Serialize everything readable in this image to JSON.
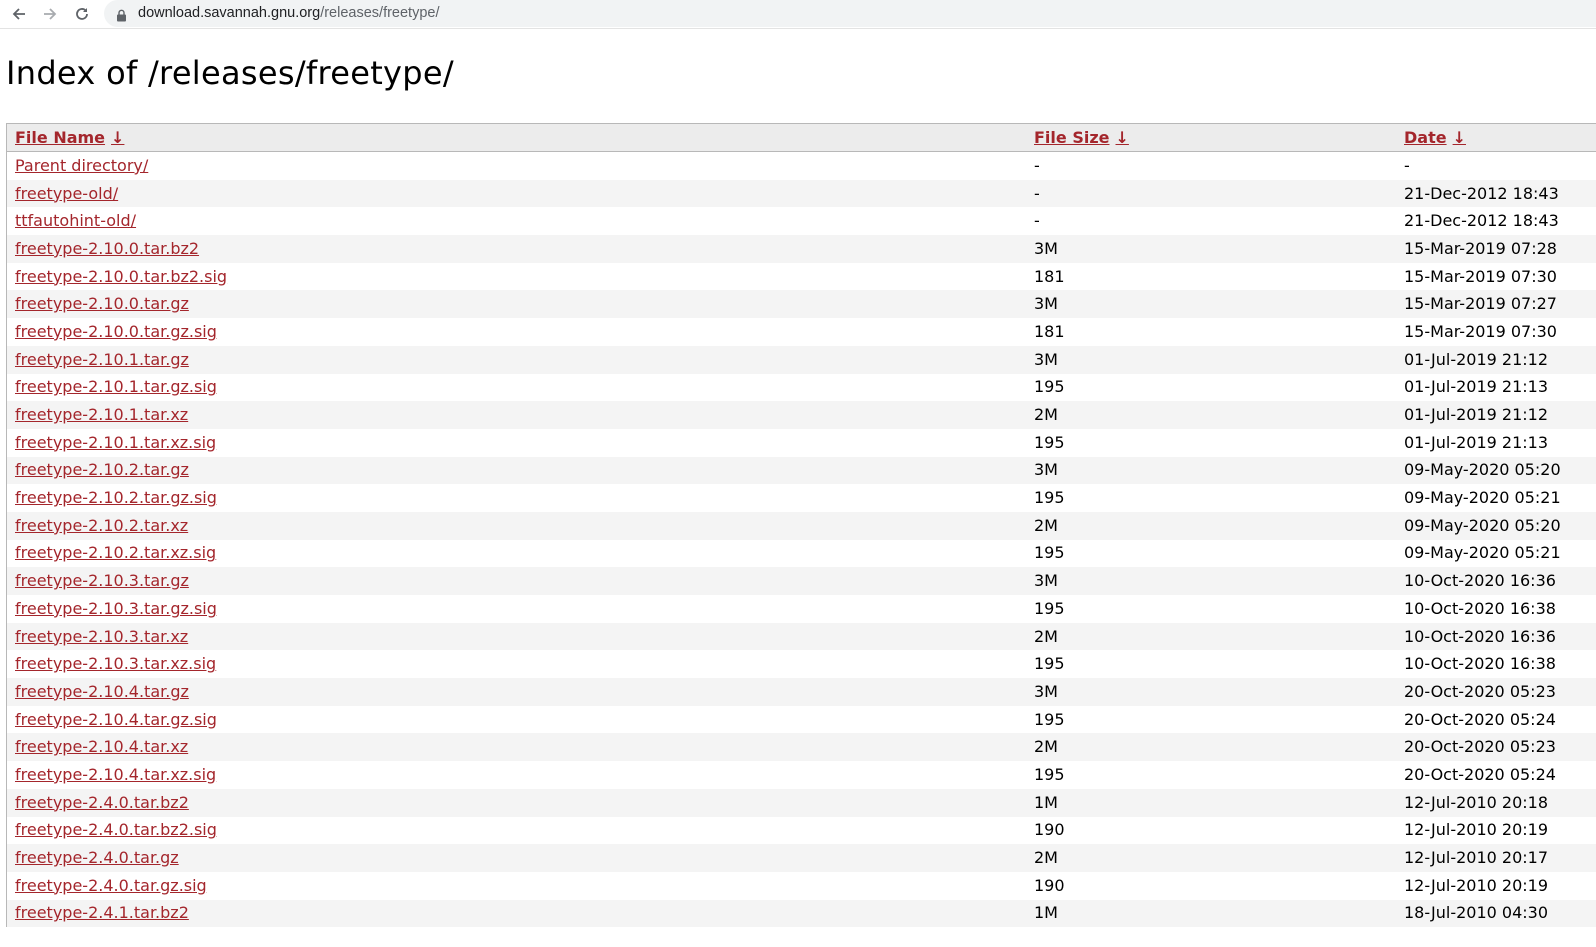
{
  "browser": {
    "url_host": "download.savannah.gnu.org",
    "url_path": "/releases/freetype/"
  },
  "page": {
    "title": "Index of /releases/freetype/"
  },
  "table": {
    "headers": {
      "name": "File Name",
      "size": "File Size",
      "date": "Date",
      "sort_arrow": "↓"
    },
    "rows": [
      {
        "name": "Parent directory/",
        "size": "-",
        "date": "-"
      },
      {
        "name": "freetype-old/",
        "size": "-",
        "date": "21-Dec-2012 18:43"
      },
      {
        "name": "ttfautohint-old/",
        "size": "-",
        "date": "21-Dec-2012 18:43"
      },
      {
        "name": "freetype-2.10.0.tar.bz2",
        "size": "3M",
        "date": "15-Mar-2019 07:28"
      },
      {
        "name": "freetype-2.10.0.tar.bz2.sig",
        "size": "181",
        "date": "15-Mar-2019 07:30"
      },
      {
        "name": "freetype-2.10.0.tar.gz",
        "size": "3M",
        "date": "15-Mar-2019 07:27"
      },
      {
        "name": "freetype-2.10.0.tar.gz.sig",
        "size": "181",
        "date": "15-Mar-2019 07:30"
      },
      {
        "name": "freetype-2.10.1.tar.gz",
        "size": "3M",
        "date": "01-Jul-2019 21:12"
      },
      {
        "name": "freetype-2.10.1.tar.gz.sig",
        "size": "195",
        "date": "01-Jul-2019 21:13"
      },
      {
        "name": "freetype-2.10.1.tar.xz",
        "size": "2M",
        "date": "01-Jul-2019 21:12"
      },
      {
        "name": "freetype-2.10.1.tar.xz.sig",
        "size": "195",
        "date": "01-Jul-2019 21:13"
      },
      {
        "name": "freetype-2.10.2.tar.gz",
        "size": "3M",
        "date": "09-May-2020 05:20"
      },
      {
        "name": "freetype-2.10.2.tar.gz.sig",
        "size": "195",
        "date": "09-May-2020 05:21"
      },
      {
        "name": "freetype-2.10.2.tar.xz",
        "size": "2M",
        "date": "09-May-2020 05:20"
      },
      {
        "name": "freetype-2.10.2.tar.xz.sig",
        "size": "195",
        "date": "09-May-2020 05:21"
      },
      {
        "name": "freetype-2.10.3.tar.gz",
        "size": "3M",
        "date": "10-Oct-2020 16:36"
      },
      {
        "name": "freetype-2.10.3.tar.gz.sig",
        "size": "195",
        "date": "10-Oct-2020 16:38"
      },
      {
        "name": "freetype-2.10.3.tar.xz",
        "size": "2M",
        "date": "10-Oct-2020 16:36"
      },
      {
        "name": "freetype-2.10.3.tar.xz.sig",
        "size": "195",
        "date": "10-Oct-2020 16:38"
      },
      {
        "name": "freetype-2.10.4.tar.gz",
        "size": "3M",
        "date": "20-Oct-2020 05:23"
      },
      {
        "name": "freetype-2.10.4.tar.gz.sig",
        "size": "195",
        "date": "20-Oct-2020 05:24"
      },
      {
        "name": "freetype-2.10.4.tar.xz",
        "size": "2M",
        "date": "20-Oct-2020 05:23"
      },
      {
        "name": "freetype-2.10.4.tar.xz.sig",
        "size": "195",
        "date": "20-Oct-2020 05:24"
      },
      {
        "name": "freetype-2.4.0.tar.bz2",
        "size": "1M",
        "date": "12-Jul-2010 20:18"
      },
      {
        "name": "freetype-2.4.0.tar.bz2.sig",
        "size": "190",
        "date": "12-Jul-2010 20:19"
      },
      {
        "name": "freetype-2.4.0.tar.gz",
        "size": "2M",
        "date": "12-Jul-2010 20:17"
      },
      {
        "name": "freetype-2.4.0.tar.gz.sig",
        "size": "190",
        "date": "12-Jul-2010 20:19"
      },
      {
        "name": "freetype-2.4.1.tar.bz2",
        "size": "1M",
        "date": "18-Jul-2010 04:30"
      }
    ]
  }
}
